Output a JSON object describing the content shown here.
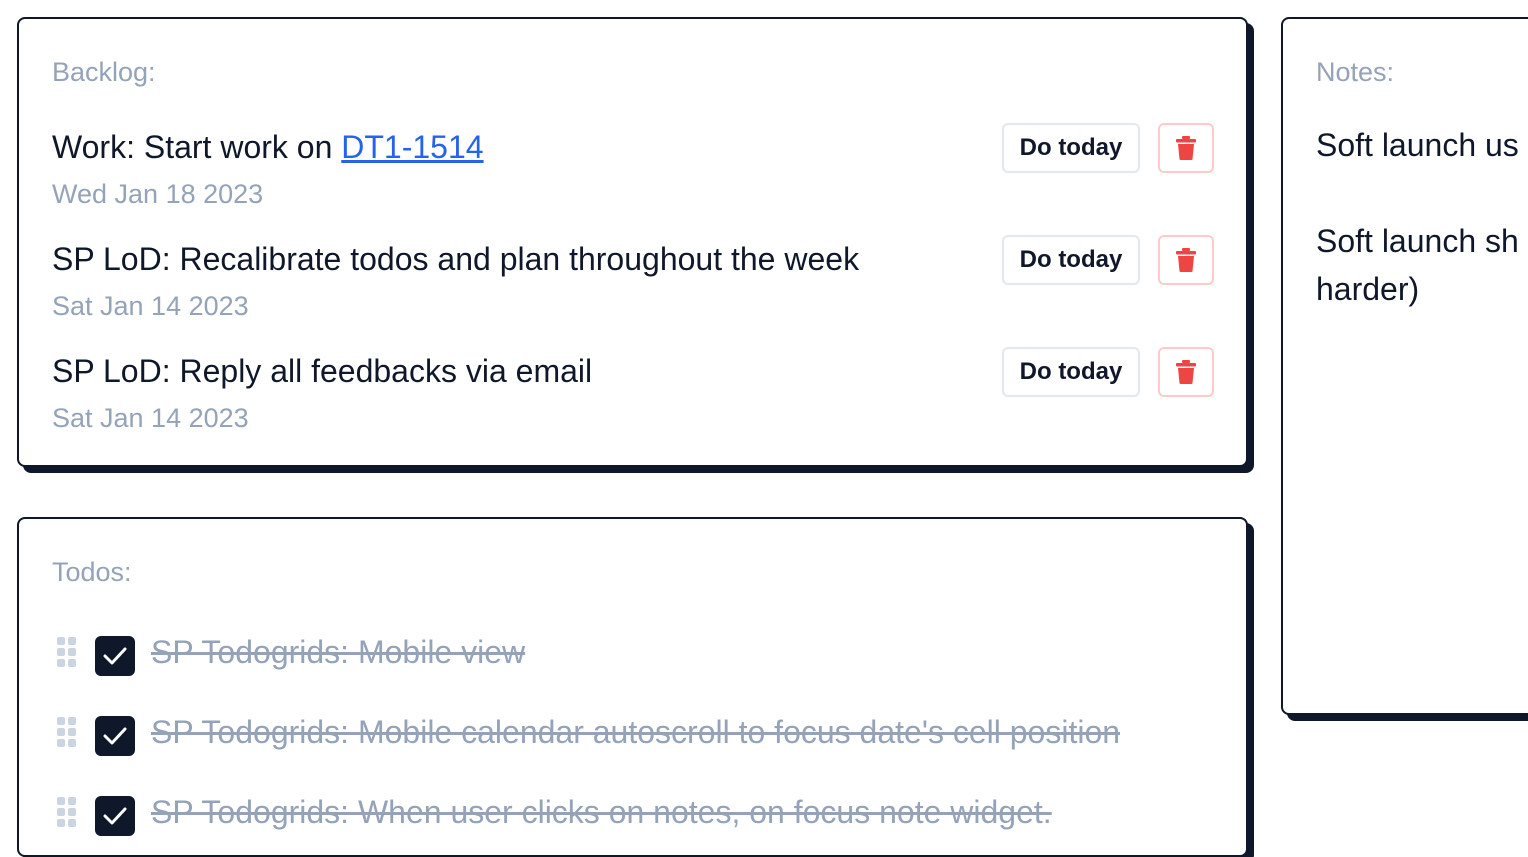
{
  "backlog": {
    "title": "Backlog:",
    "items": [
      {
        "text_prefix": "Work: Start work on ",
        "link": "DT1-1514",
        "date": "Wed Jan 18 2023",
        "do_today_label": "Do today"
      },
      {
        "text": "SP LoD: Recalibrate todos and plan throughout the week",
        "date": "Sat Jan 14 2023",
        "do_today_label": "Do today"
      },
      {
        "text": "SP LoD: Reply all feedbacks via email",
        "date": "Sat Jan 14 2023",
        "do_today_label": "Do today"
      }
    ]
  },
  "todos": {
    "title": "Todos:",
    "items": [
      {
        "text": "SP Todogrids: Mobile view",
        "done": true
      },
      {
        "text": "SP Todogrids: Mobile calendar autoscroll to focus date's cell position",
        "done": true
      },
      {
        "text": "SP Todogrids: When user clicks on notes, on focus note widget.",
        "done": true
      }
    ]
  },
  "notes": {
    "title": "Notes:",
    "lines": [
      "Soft launch us",
      "Soft launch sh",
      "harder)"
    ]
  },
  "colors": {
    "accent_dark": "#0f172a",
    "muted_text": "#94a3b8",
    "link": "#2563eb",
    "danger": "#ef4444"
  },
  "icons": {
    "delete": "trash-icon",
    "drag": "drag-handle-icon",
    "check": "check-icon"
  }
}
